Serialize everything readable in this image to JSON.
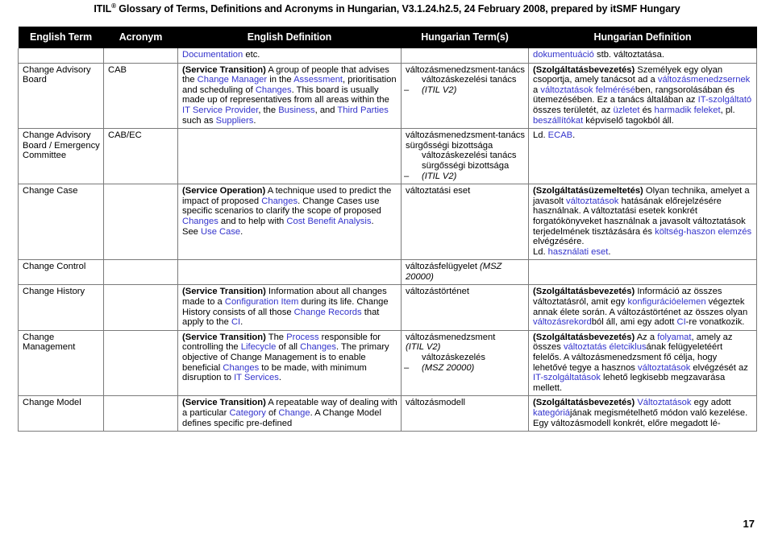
{
  "document": {
    "header_pre": "ITIL",
    "header_sup": "®",
    "header_post": " Glossary of Terms, Definitions and Acronyms in Hungarian, V3.1.24.h2.5, 24 February 2008, prepared by itSMF Hungary",
    "page_number": "17"
  },
  "table": {
    "columns": [
      {
        "label": "English Term"
      },
      {
        "label": "Acronym"
      },
      {
        "label": "English Definition"
      },
      {
        "label": "Hungarian Term(s)"
      },
      {
        "label": "Hungarian Definition"
      }
    ],
    "continuation_row": {
      "english_term": "",
      "acronym": "",
      "english_definition_plain": "Documentation etc.",
      "hungarian_term": "",
      "hungarian_definition_plain": "dokumentuáció stb. változtatása."
    },
    "rows": [
      {
        "english_term": "Change Advisory Board",
        "acronym": "CAB",
        "english_definition_plain": "(Service Transition) A group of people that advises the Change Manager in the Assessment, prioritisation and scheduling of Changes. This board is usually made up of representatives from all areas within the IT Service Provider, the Business, and Third Parties such as Suppliers.",
        "hungarian_term_main": "változásmenedzsment-tanács",
        "hungarian_term_sub": "változáskezelési tanács",
        "hungarian_term_sub_note": "(ITIL V2)",
        "hungarian_definition_plain": "(Szolgáltatásbevezetés) Személyek egy olyan csoportja, amely tanácsot ad a változásmenedzsernek a változtatások felmérésében, rangsorolásában és ütemezésében. Ez a tanács általában az IT-szolgáltató összes területét, az üzletet és harmadik feleket, pl. beszállítókat képviselő tagokból áll."
      },
      {
        "english_term": "Change Advisory Board / Emergency Committee",
        "acronym": "CAB/EC",
        "english_definition_plain": "",
        "hungarian_term_main": "változásmenedzsment-tanács sürgősségi bizottsága",
        "hungarian_term_sub": "változáskezelési tanács sürgősségi bizottsága",
        "hungarian_term_sub_note": "(ITIL V2)",
        "hungarian_definition_plain": "Ld. ECAB."
      },
      {
        "english_term": "Change Case",
        "acronym": "",
        "english_definition_plain": "(Service Operation) A technique used to predict the impact of proposed Changes. Change Cases use specific scenarios to clarify the scope of proposed Changes and to help with Cost Benefit Analysis. See Use Case.",
        "hungarian_term_main": "változtatási eset",
        "hungarian_term_sub": "",
        "hungarian_term_sub_note": "",
        "hungarian_definition_plain": "(Szolgáltatásüzemeltetés) Olyan technika, amelyet a javasolt változtatások hatásának előrejelzésére használnak. A változtatási esetek konkrét forgatókönyveket használnak a javasolt változtatások terjedelmének tisztázására és költség-haszon elemzés elvégzésére. Ld. használati eset."
      },
      {
        "english_term": "Change Control",
        "acronym": "",
        "english_definition_plain": "",
        "hungarian_term_main": "változásfelügyelet",
        "hungarian_term_main_note": "(MSZ 20000)",
        "hungarian_term_sub": "",
        "hungarian_term_sub_note": "",
        "hungarian_definition_plain": ""
      },
      {
        "english_term": "Change History",
        "acronym": "",
        "english_definition_plain": "(Service Transition) Information about all changes made to a Configuration Item during its life. Change History consists of all those Change Records that apply to the CI.",
        "hungarian_term_main": "változástörténet",
        "hungarian_term_sub": "",
        "hungarian_term_sub_note": "",
        "hungarian_definition_plain": "(Szolgáltatásbevezetés) Információ az összes változtatásról, amit egy konfigurációelemen végeztek annak élete során. A változástörténet az összes olyan változásrekordból áll, ami egy adott CI-re vonatkozik."
      },
      {
        "english_term": "Change Management",
        "acronym": "",
        "english_definition_plain": "(Service Transition) The Process responsible for controlling the Lifecycle of all Changes. The primary objective of Change Management is to enable beneficial Changes to be made, with minimum disruption to IT Services.",
        "hungarian_term_main": "változásmenedzsment",
        "hungarian_term_main_note": "(ITIL V2)",
        "hungarian_term_sub": "változáskezelés",
        "hungarian_term_sub_note": "(MSZ 20000)",
        "hungarian_definition_plain": "(Szolgáltatásbevezetés) Az a folyamat, amely az összes változtatás életciklusának felügyeletéért felelős. A változásmenedzsment fő célja, hogy lehetővé tegye a hasznos változtatások elvégzését az IT-szolgáltatások lehető legkisebb megzavarása mellett."
      },
      {
        "english_term": "Change Model",
        "acronym": "",
        "english_definition_plain": "(Service Transition) A repeatable way of dealing with a particular Category of Change. A Change Model defines specific pre-defined",
        "hungarian_term_main": "változásmodell",
        "hungarian_term_sub": "",
        "hungarian_term_sub_note": "",
        "hungarian_definition_plain": "(Szolgáltatásbevezetés) Változtatások egy adott kategóriájának megismételhető módon való kezelése. Egy változásmodell konkrét, előre megadott lé-"
      }
    ]
  },
  "colors": {
    "link": "#3333cc",
    "header_bg": "#000000",
    "header_fg": "#ffffff",
    "border": "#7a7a7a"
  }
}
